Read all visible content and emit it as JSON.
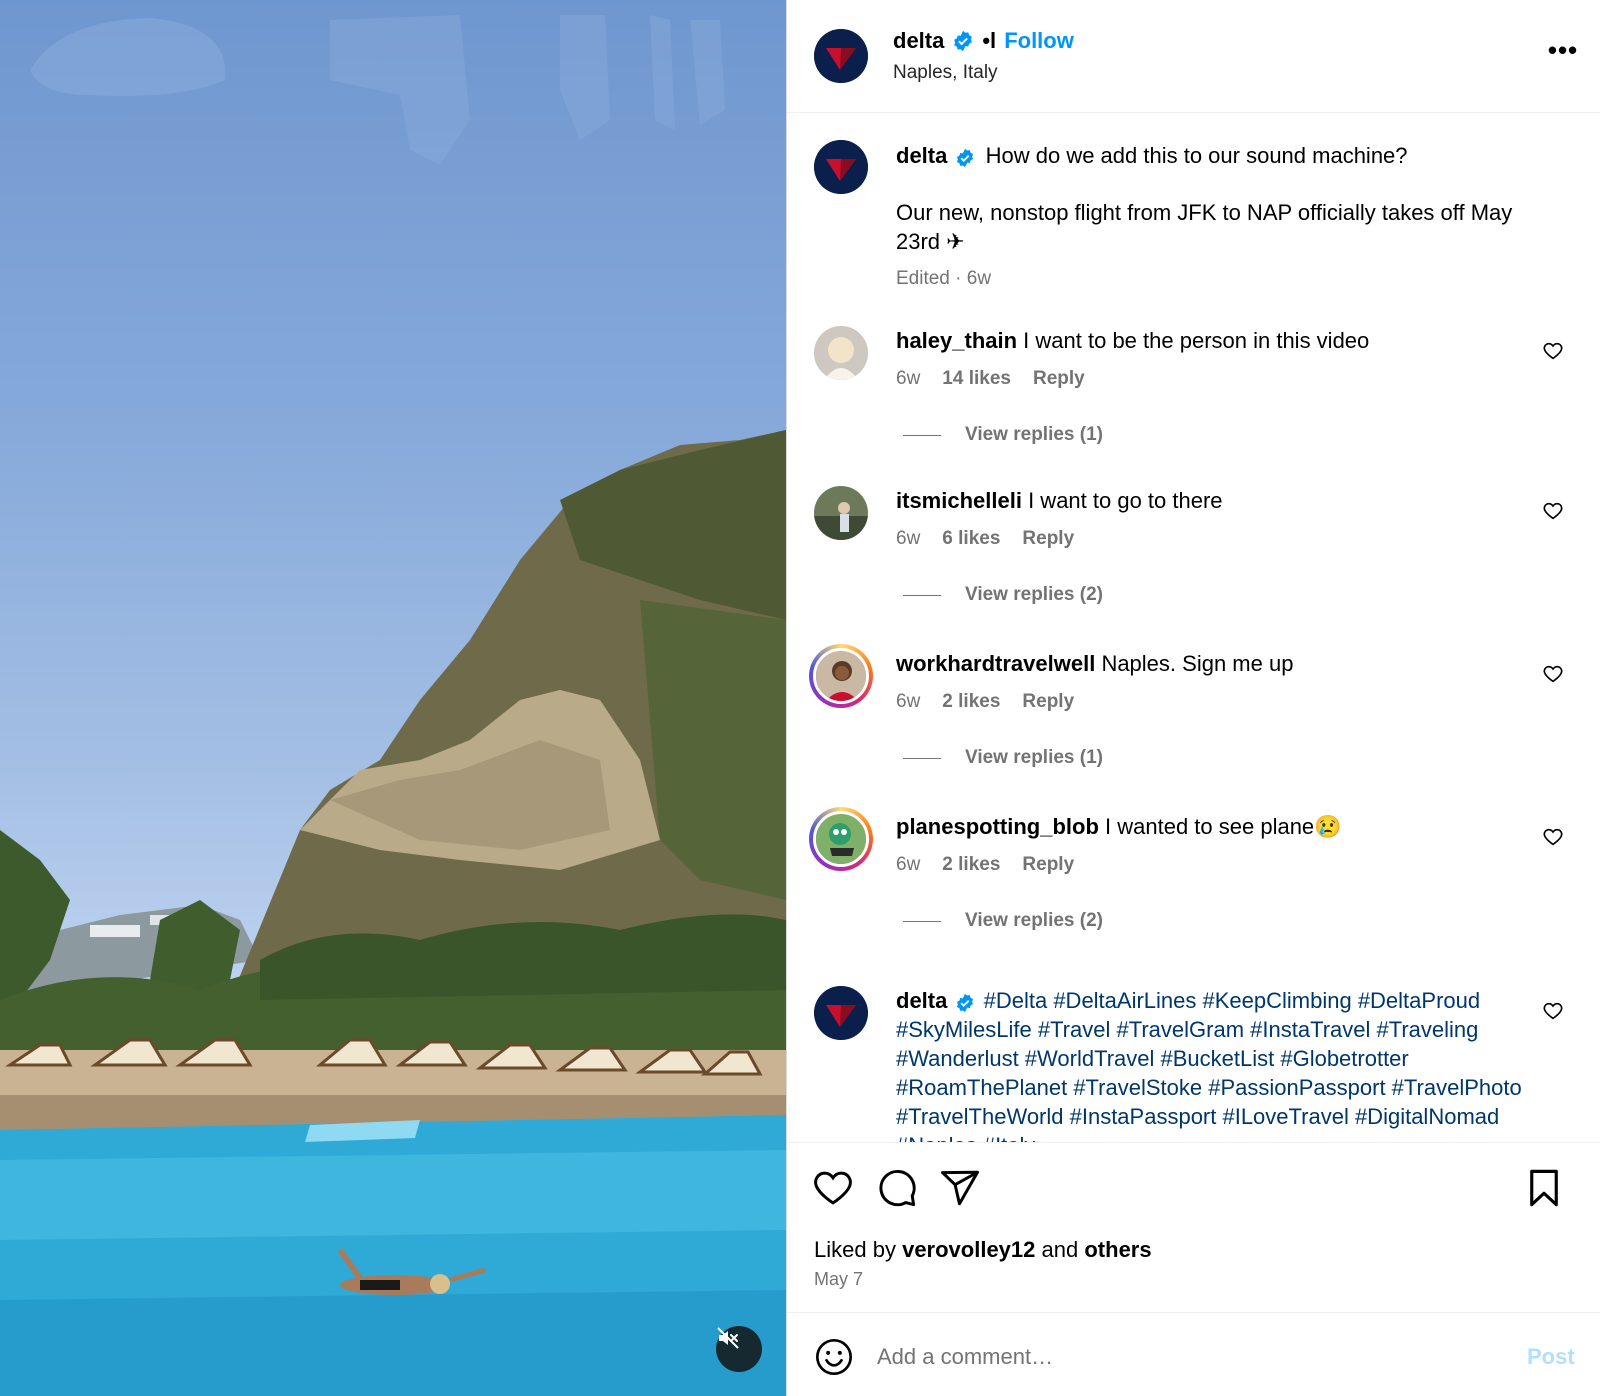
{
  "post": {
    "username": "delta",
    "separator": "•l",
    "follow_label": "Follow",
    "location": "Naples, Italy",
    "more_label": "•••"
  },
  "caption": {
    "username": "delta",
    "line1": "How do we add this to our sound machine?",
    "line2": "Our new, nonstop flight from JFK to NAP officially takes off May 23rd ✈",
    "meta": "Edited · 6w"
  },
  "comments": [
    {
      "username": "haley_thain",
      "text": "I want to be the person in this video",
      "time": "6w",
      "likes": "14 likes",
      "reply": "Reply",
      "replies": "View replies (1)"
    },
    {
      "username": "itsmichelleli",
      "text": "I want to go to there",
      "time": "6w",
      "likes": "6 likes",
      "reply": "Reply",
      "replies": "View replies (2)"
    },
    {
      "username": "workhardtravelwell",
      "text": "Naples. Sign me up",
      "time": "6w",
      "likes": "2 likes",
      "reply": "Reply",
      "replies": "View replies (1)"
    },
    {
      "username": "planespotting_blob",
      "text": "I wanted to see plane😢",
      "time": "6w",
      "likes": "2 likes",
      "reply": "Reply",
      "replies": "View replies (2)"
    }
  ],
  "hashtag_comment": {
    "username": "delta",
    "tags": "#Delta #DeltaAirLines #KeepClimbing #DeltaProud #SkyMilesLife #Travel #TravelGram #InstaTravel #Traveling #Wanderlust #WorldTravel #BucketList #Globetrotter #RoamThePlanet #TravelStoke #PassionPassport #TravelPhoto #TravelTheWorld #InstaPassport #ILoveTravel #DigitalNomad #Naples #Italy"
  },
  "likes": {
    "prefix": "Liked by",
    "user": "verovolley12",
    "and": "and",
    "others": "others",
    "date": "May 7"
  },
  "add_comment": {
    "placeholder": "Add a comment…",
    "post_label": "Post"
  },
  "icons": {
    "verified": "verified-badge-icon",
    "heart": "heart-icon",
    "comment": "comment-icon",
    "share": "share-icon",
    "save": "bookmark-icon",
    "emoji": "emoji-icon",
    "mute": "muted-speaker-icon"
  },
  "colors": {
    "link": "#0095f6",
    "hashtag": "#00376b",
    "muted_text": "#737373",
    "post_disabled": "#b2dffc",
    "delta_red": "#c8102e",
    "delta_navy": "#0b1f4d"
  }
}
